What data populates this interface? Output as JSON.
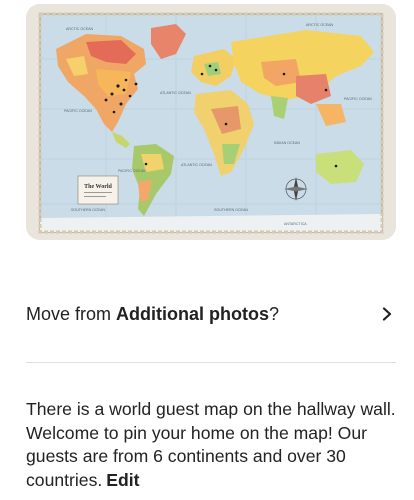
{
  "photo": {
    "alt": "World map on hallway wall",
    "map_title": "The World",
    "ocean_labels": [
      "ARCTIC OCEAN",
      "ARCTIC OCEAN",
      "PACIFIC OCEAN",
      "ATLANTIC OCEAN",
      "INDIAN OCEAN",
      "PACIFIC OCEAN",
      "PACIFIC OCEAN",
      "ATLANTIC OCEAN",
      "SOUTHERN OCEAN",
      "SOUTHERN OCEAN",
      "ANTARCTICA"
    ]
  },
  "move_row": {
    "prefix": "Move from ",
    "bold": "Additional photos",
    "suffix": "?"
  },
  "description": {
    "text": "There is a world guest map on the hallway wall. Welcome to pin your home on the map! Our guests are from 6 continents and over 30 countries.",
    "edit_label": "Edit"
  },
  "colors": {
    "text": "#222222",
    "divider": "#dddddd",
    "ocean": "#cfe0ea"
  }
}
